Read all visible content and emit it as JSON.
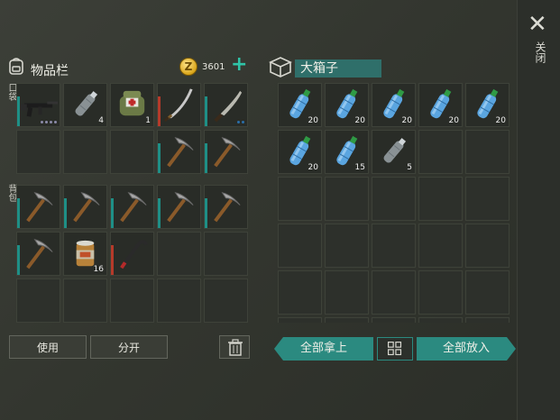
{
  "inventory": {
    "title": "物品栏",
    "coins": "3601",
    "pocket_label": "口袋",
    "backpack_label": "背包",
    "pocket_slots": [
      {
        "item": "rifle",
        "count": "",
        "dots": true,
        "durability": true
      },
      {
        "item": "empty-bottle",
        "count": "4"
      },
      {
        "item": "medkit-bag",
        "count": "1"
      },
      {
        "item": "katana",
        "count": "",
        "durability": true,
        "durability_color": "red"
      },
      {
        "item": "machete",
        "count": "",
        "durability": true,
        "dots_small": true
      },
      {
        "item": "",
        "count": ""
      },
      {
        "item": "",
        "count": ""
      },
      {
        "item": "",
        "count": ""
      },
      {
        "item": "pickaxe",
        "count": "",
        "durability": true
      },
      {
        "item": "pickaxe",
        "count": "",
        "durability": true
      }
    ],
    "backpack_slots": [
      {
        "item": "pickaxe",
        "count": "",
        "durability": true
      },
      {
        "item": "pickaxe",
        "count": "",
        "durability": true
      },
      {
        "item": "pickaxe",
        "count": "",
        "durability": true
      },
      {
        "item": "pickaxe",
        "count": "",
        "durability": true
      },
      {
        "item": "pickaxe",
        "count": "",
        "durability": true
      },
      {
        "item": "pickaxe",
        "count": "",
        "durability": true
      },
      {
        "item": "canned-food",
        "count": "16"
      },
      {
        "item": "crowbar",
        "count": "",
        "durability": true,
        "durability_color": "red"
      },
      {
        "item": "",
        "count": ""
      },
      {
        "item": "",
        "count": ""
      },
      {
        "item": "",
        "count": ""
      },
      {
        "item": "",
        "count": ""
      },
      {
        "item": "",
        "count": ""
      },
      {
        "item": "",
        "count": ""
      },
      {
        "item": "",
        "count": ""
      }
    ],
    "use_label": "使用",
    "split_label": "分开"
  },
  "chest": {
    "title": "大箱子",
    "slots": [
      {
        "item": "water-bottle",
        "count": "20"
      },
      {
        "item": "water-bottle",
        "count": "20"
      },
      {
        "item": "water-bottle",
        "count": "20"
      },
      {
        "item": "water-bottle",
        "count": "20"
      },
      {
        "item": "water-bottle",
        "count": "20"
      },
      {
        "item": "water-bottle",
        "count": "20"
      },
      {
        "item": "water-bottle",
        "count": "15"
      },
      {
        "item": "empty-bottle",
        "count": "5"
      },
      {
        "item": "",
        "count": ""
      },
      {
        "item": "",
        "count": ""
      },
      {
        "item": "",
        "count": ""
      },
      {
        "item": "",
        "count": ""
      },
      {
        "item": "",
        "count": ""
      },
      {
        "item": "",
        "count": ""
      },
      {
        "item": "",
        "count": ""
      },
      {
        "item": "",
        "count": ""
      },
      {
        "item": "",
        "count": ""
      },
      {
        "item": "",
        "count": ""
      },
      {
        "item": "",
        "count": ""
      },
      {
        "item": "",
        "count": ""
      },
      {
        "item": "",
        "count": ""
      },
      {
        "item": "",
        "count": ""
      },
      {
        "item": "",
        "count": ""
      },
      {
        "item": "",
        "count": ""
      },
      {
        "item": "",
        "count": ""
      },
      {
        "item": "",
        "count": ""
      },
      {
        "item": "",
        "count": ""
      },
      {
        "item": "",
        "count": ""
      },
      {
        "item": "",
        "count": ""
      },
      {
        "item": "",
        "count": ""
      }
    ],
    "take_all_label": "全部拿上",
    "put_all_label": "全部放入"
  },
  "close_label": "关闭",
  "colors": {
    "accent": "#2b8a80",
    "durability": "#1e8f86",
    "coin": "#d9a51a"
  }
}
